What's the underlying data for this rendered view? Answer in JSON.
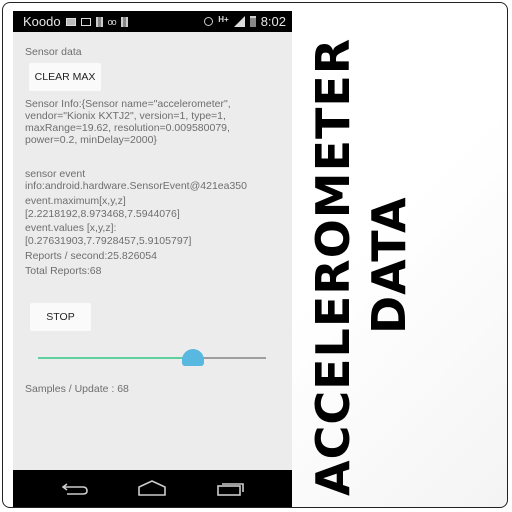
{
  "statusbar": {
    "carrier": "Koodo",
    "network": "H+",
    "time": "8:02",
    "icons": [
      "mail-icon",
      "image-icon",
      "barcode-icon",
      "voicemail-icon",
      "barcode-icon",
      "alarm-icon",
      "network-type-icon",
      "signal-icon",
      "battery-icon"
    ]
  },
  "app": {
    "heading": "Sensor data",
    "clear_max_label": "CLEAR MAX",
    "sensor_info": [
      "Sensor Info:{Sensor name=\"accelerometer\",",
      "vendor=\"Kionix KXTJ2\", version=1, type=1,",
      "maxRange=19.62, resolution=0.009580079,",
      "power=0.2, minDelay=2000}"
    ],
    "event_lines": [
      "sensor event",
      "info:android.hardware.SensorEvent@421ea350",
      "event.maximum[x,y,z]",
      "[2.2218192,8.973468,7.5944076]",
      "event.values [x,y,z]:",
      "[0.27631903,7.7928457,5.9105797]",
      "Reports / second:25.826054",
      "Total Reports:68"
    ],
    "stop_label": "STOP",
    "slider": {
      "value_fraction": 0.68,
      "active_color": "#5ecf9e",
      "thumb_color": "#58b8e0"
    },
    "samples_label": "Samples / Update : 68"
  },
  "navbar": {
    "buttons": [
      "back-icon",
      "home-icon",
      "recents-icon"
    ]
  },
  "banner": {
    "line1": "ACCELEROMETER",
    "line2": "DATA"
  }
}
